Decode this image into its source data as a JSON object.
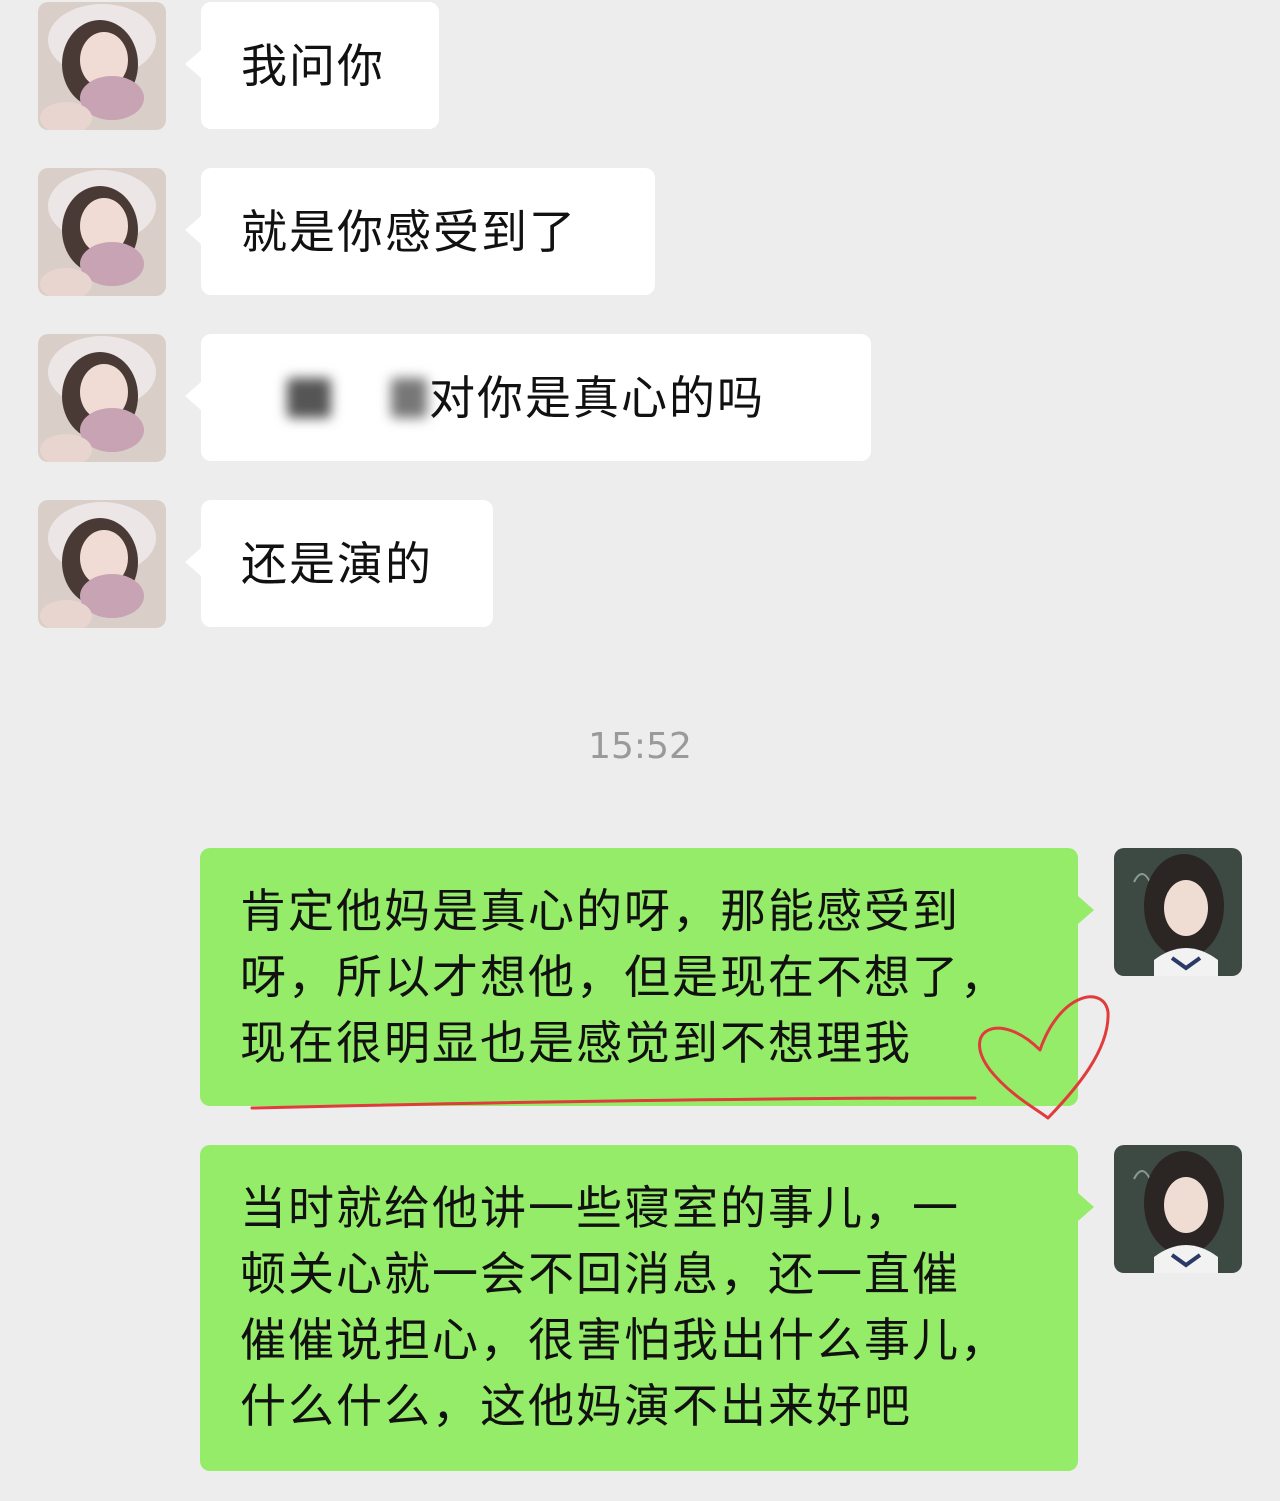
{
  "colors": {
    "background": "#ededed",
    "incoming_bubble": "#ffffff",
    "outgoing_bubble": "#95ec69",
    "timestamp": "#9a9a9a",
    "annotation_ink": "#e03c3c"
  },
  "incoming_messages": [
    {
      "text": "我问你",
      "avatar": "contact-avatar"
    },
    {
      "text": "就是你感受到了",
      "avatar": "contact-avatar"
    },
    {
      "text": "对你是真心的吗",
      "avatar": "contact-avatar",
      "has_redacted_prefix": true
    },
    {
      "text": "还是演的",
      "avatar": "contact-avatar"
    }
  ],
  "timestamp": "15:52",
  "outgoing_messages": [
    {
      "lines": [
        "肯定他妈是真心的呀，那能感受到",
        "呀，所以才想他，但是现在不想了，",
        "现在很明显也是感觉到不想理我"
      ],
      "avatar": "self-avatar"
    },
    {
      "lines": [
        "当时就给他讲一些寝室的事儿，一",
        "顿关心就一会不回消息，还一直催",
        "催催说担心，很害怕我出什么事儿，",
        "什么什么，这他妈演不出来好吧"
      ],
      "avatar": "self-avatar"
    }
  ],
  "annotations": [
    "underline",
    "heart"
  ]
}
